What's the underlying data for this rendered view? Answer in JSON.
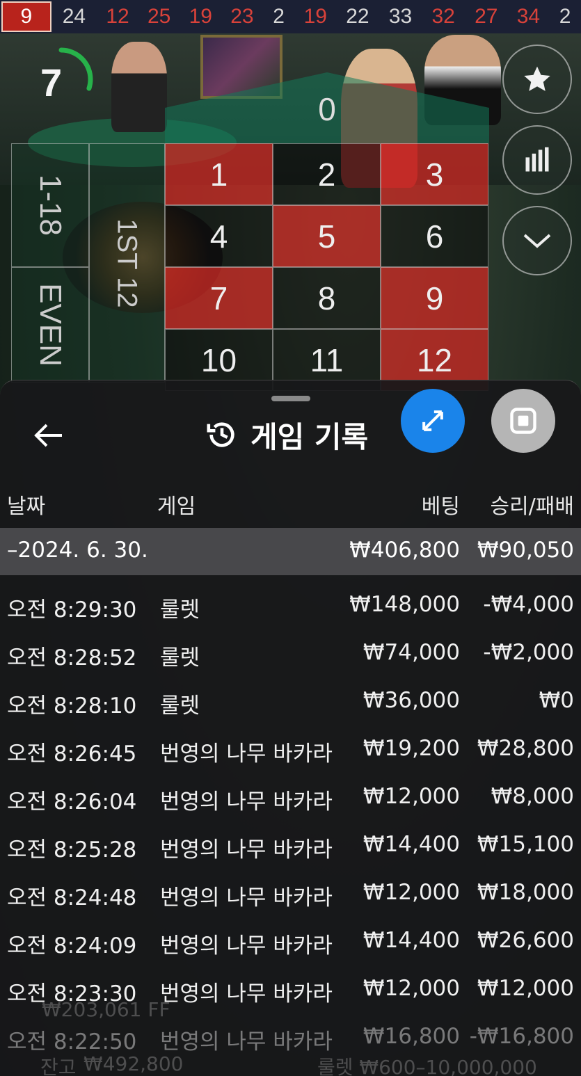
{
  "recent_numbers": [
    {
      "value": "9",
      "color": "red"
    },
    {
      "value": "24",
      "color": "black"
    },
    {
      "value": "12",
      "color": "red"
    },
    {
      "value": "25",
      "color": "red"
    },
    {
      "value": "19",
      "color": "red"
    },
    {
      "value": "23",
      "color": "red"
    },
    {
      "value": "2",
      "color": "black"
    },
    {
      "value": "19",
      "color": "red"
    },
    {
      "value": "22",
      "color": "black"
    },
    {
      "value": "33",
      "color": "black"
    },
    {
      "value": "32",
      "color": "red"
    },
    {
      "value": "27",
      "color": "red"
    },
    {
      "value": "34",
      "color": "red"
    },
    {
      "value": "2",
      "color": "black"
    }
  ],
  "timer": {
    "seconds": "7",
    "progress": 0.3
  },
  "board": {
    "zero": "0",
    "numbers": [
      {
        "n": "1",
        "color": "red"
      },
      {
        "n": "2",
        "color": "black"
      },
      {
        "n": "3",
        "color": "red"
      },
      {
        "n": "4",
        "color": "black"
      },
      {
        "n": "5",
        "color": "red"
      },
      {
        "n": "6",
        "color": "black"
      },
      {
        "n": "7",
        "color": "red"
      },
      {
        "n": "8",
        "color": "black"
      },
      {
        "n": "9",
        "color": "red"
      },
      {
        "n": "10",
        "color": "black"
      },
      {
        "n": "11",
        "color": "black"
      },
      {
        "n": "12",
        "color": "red"
      }
    ],
    "range_label": "1-18",
    "even_label": "EVEN",
    "dozen_label": "1ST 12"
  },
  "side_buttons": [
    {
      "name": "favorite-button",
      "icon": "star-icon"
    },
    {
      "name": "stats-button",
      "icon": "bar-chart-icon"
    },
    {
      "name": "collapse-button",
      "icon": "chevron-down-icon"
    }
  ],
  "panel": {
    "title": "게임 기록",
    "back_icon": "arrow-left-icon",
    "history_icon": "history-icon",
    "expand_icon": "expand-icon",
    "stop_icon": "stop-icon",
    "columns": {
      "date": "날짜",
      "game": "게임",
      "bet": "베팅",
      "result": "승리/패배"
    },
    "date_group": {
      "date": "–2024. 6. 30.",
      "bet": "₩406,800",
      "result": "₩90,050"
    },
    "rows": [
      {
        "time": "오전 8:29:30",
        "game": "룰렛",
        "bet": "₩148,000",
        "result": "-₩4,000"
      },
      {
        "time": "오전 8:28:52",
        "game": "룰렛",
        "bet": "₩74,000",
        "result": "-₩2,000"
      },
      {
        "time": "오전 8:28:10",
        "game": "룰렛",
        "bet": "₩36,000",
        "result": "₩0"
      },
      {
        "time": "오전 8:26:45",
        "game": "번영의 나무 바카라",
        "bet": "₩19,200",
        "result": "₩28,800"
      },
      {
        "time": "오전 8:26:04",
        "game": "번영의 나무 바카라",
        "bet": "₩12,000",
        "result": "₩8,000"
      },
      {
        "time": "오전 8:25:28",
        "game": "번영의 나무 바카라",
        "bet": "₩14,400",
        "result": "₩15,100"
      },
      {
        "time": "오전 8:24:48",
        "game": "번영의 나무 바카라",
        "bet": "₩12,000",
        "result": "₩18,000"
      },
      {
        "time": "오전 8:24:09",
        "game": "번영의 나무 바카라",
        "bet": "₩14,400",
        "result": "₩26,600"
      },
      {
        "time": "오전 8:23:30",
        "game": "번영의 나무 바카라",
        "bet": "₩12,000",
        "result": "₩12,000"
      },
      {
        "time": "오전 8:22:50",
        "game": "번영의 나무 바카라",
        "bet": "₩16,800",
        "result": "-₩16,800"
      }
    ]
  },
  "footer": {
    "balance_label": "잔고",
    "balance_value": "₩492,800",
    "table_limit": "룰렛 ₩600–10,000,000",
    "bonus": "₩203,061 FF"
  },
  "colors": {
    "accent": "#1a84ea",
    "red": "#c8281f",
    "panel": "#18181a"
  }
}
